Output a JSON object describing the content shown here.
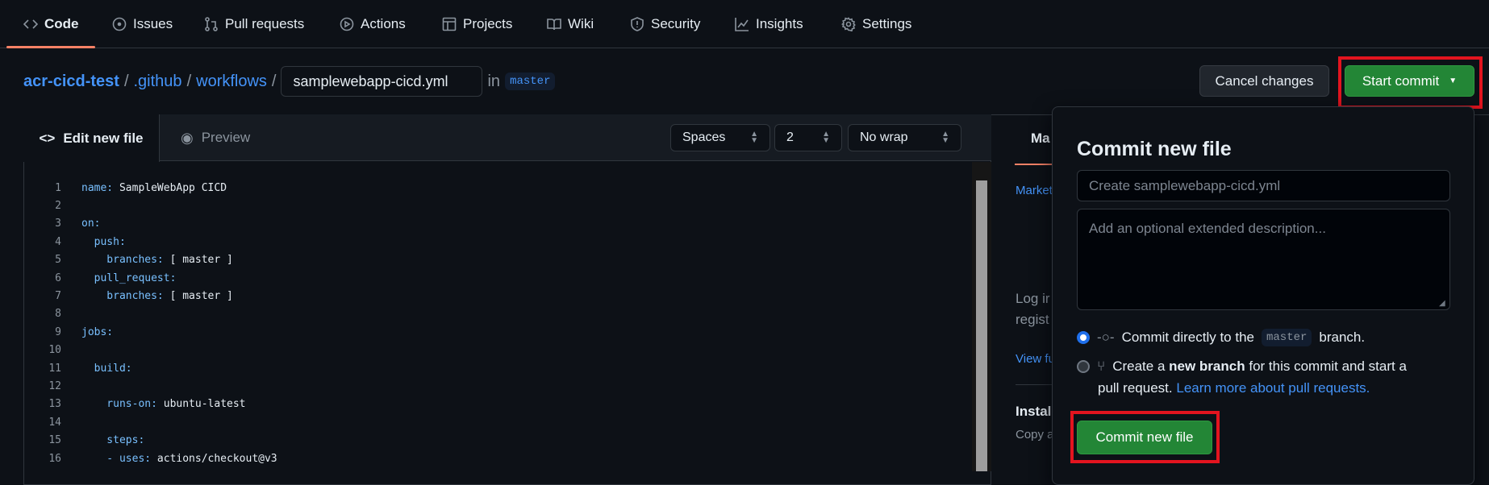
{
  "nav": {
    "tabs": [
      {
        "label": "Code",
        "icon": "code-icon"
      },
      {
        "label": "Issues",
        "icon": "issue-icon"
      },
      {
        "label": "Pull requests",
        "icon": "pull-request-icon"
      },
      {
        "label": "Actions",
        "icon": "play-icon"
      },
      {
        "label": "Projects",
        "icon": "table-icon"
      },
      {
        "label": "Wiki",
        "icon": "book-icon"
      },
      {
        "label": "Security",
        "icon": "shield-icon"
      },
      {
        "label": "Insights",
        "icon": "graph-icon"
      },
      {
        "label": "Settings",
        "icon": "gear-icon"
      }
    ]
  },
  "breadcrumb": {
    "repo": "acr-cicd-test",
    "dir1": ".github",
    "dir2": "workflows",
    "sep": "/",
    "filename": "samplewebapp-cicd.yml",
    "in": "in",
    "branch": "master"
  },
  "actions": {
    "cancel": "Cancel changes",
    "start_commit": "Start commit"
  },
  "editor": {
    "tab_edit": "Edit new file",
    "tab_preview": "Preview",
    "indent_mode": "Spaces",
    "indent_size": "2",
    "wrap_mode": "No wrap",
    "lines": [
      {
        "n": "1",
        "key": "name:",
        "val": " SampleWebApp CICD"
      },
      {
        "n": "2",
        "key": "",
        "val": ""
      },
      {
        "n": "3",
        "key": "on:",
        "val": ""
      },
      {
        "n": "4",
        "key": "  push:",
        "val": ""
      },
      {
        "n": "5",
        "key": "    branches:",
        "val": " [ master ]"
      },
      {
        "n": "6",
        "key": "  pull_request:",
        "val": ""
      },
      {
        "n": "7",
        "key": "    branches:",
        "val": " [ master ]"
      },
      {
        "n": "8",
        "key": "",
        "val": ""
      },
      {
        "n": "9",
        "key": "jobs:",
        "val": ""
      },
      {
        "n": "10",
        "key": "",
        "val": ""
      },
      {
        "n": "11",
        "key": "  build:",
        "val": ""
      },
      {
        "n": "12",
        "key": "",
        "val": ""
      },
      {
        "n": "13",
        "key": "    runs-on:",
        "val": " ubuntu-latest"
      },
      {
        "n": "14",
        "key": "",
        "val": ""
      },
      {
        "n": "15",
        "key": "    steps:",
        "val": ""
      },
      {
        "n": "16",
        "key": "    - uses:",
        "val": " actions/checkout@v3"
      }
    ]
  },
  "sidebar": {
    "tab": "Ma",
    "market": "Market",
    "log1": "Log ir",
    "log2": "regist",
    "view": "View fu",
    "install": "Install",
    "copy": "Copy a"
  },
  "commit": {
    "title": "Commit new file",
    "summary_placeholder": "Create samplewebapp-cicd.yml",
    "desc_placeholder": "Add an optional extended description...",
    "opt1_pre": "Commit directly to the",
    "opt1_branch": "master",
    "opt1_post": "branch.",
    "opt2_pre": "Create a",
    "opt2_bold": "new branch",
    "opt2_post": "for this commit and start a",
    "opt2_line2": "pull request.",
    "opt2_link": "Learn more about pull requests.",
    "submit": "Commit new file"
  },
  "colors": {
    "accent": "#238636",
    "link": "#4493f8",
    "highlight": "#e3141f"
  }
}
